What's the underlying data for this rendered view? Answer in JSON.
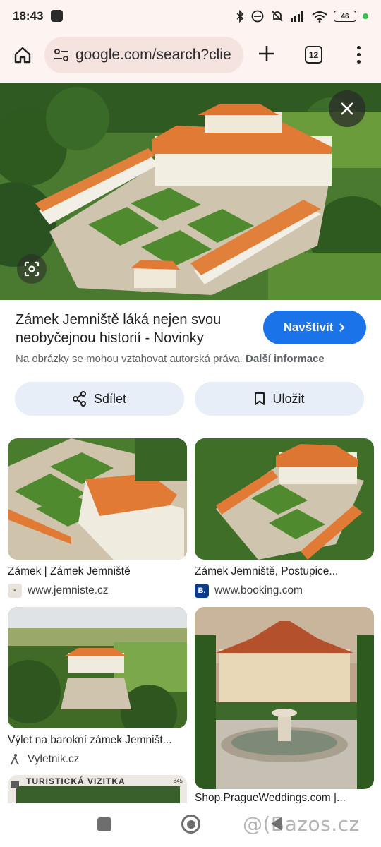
{
  "status_bar": {
    "time": "18:43",
    "battery": "46",
    "icons": [
      "bluetooth-icon",
      "link-icon",
      "bell-muted-icon",
      "signal-icon",
      "wifi-icon",
      "battery-icon"
    ]
  },
  "toolbar": {
    "url": "google.com/search?clie",
    "tab_count": "12"
  },
  "result": {
    "title": "Zámek Jemniště láká nejen svou neobyčejnou historií - Novinky",
    "visit_label": "Navštívit",
    "copyright_text": "Na obrázky se mohou vztahovat autorská práva.",
    "copyright_link": "Další informace",
    "share_label": "Sdílet",
    "save_label": "Uložit"
  },
  "related": [
    {
      "title": "Zámek | Zámek Jemniště",
      "source": "www.jemniste.cz"
    },
    {
      "title": "Zámek Jemniště, Postupice...",
      "source": "www.booking.com",
      "favicon_letter": "B."
    },
    {
      "title": "Výlet na barokní zámek Jemništ...",
      "source": "Vyletnik.cz"
    },
    {
      "title": "Shop.PragueWeddings.com |..."
    },
    {
      "image_text": "TURISTICKÁ VIZITKA",
      "image_number": "345"
    }
  ],
  "watermark": "@(Bazos.cz",
  "colors": {
    "accent": "#1a73e8",
    "chrome_bg": "#fdf3f1",
    "pill_bg": "#f5e3df",
    "chip_bg": "#e7eef8"
  }
}
